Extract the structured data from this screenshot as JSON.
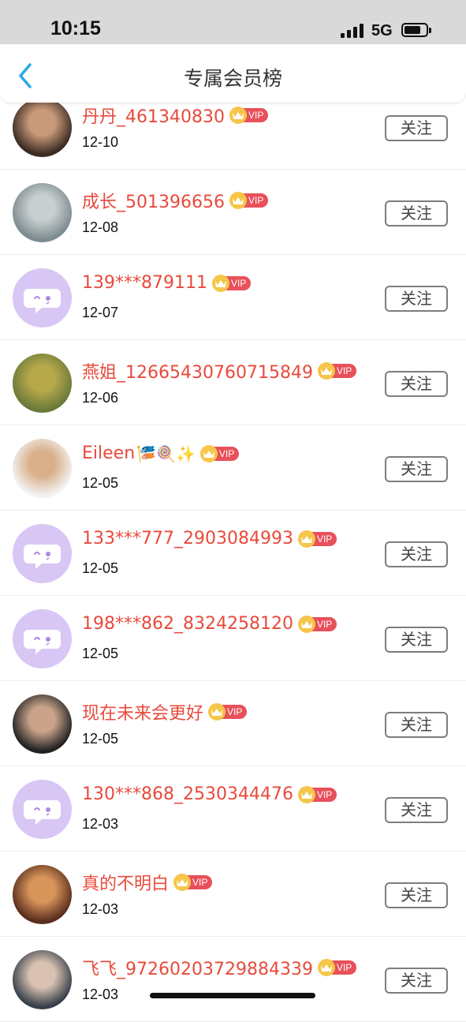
{
  "status_bar": {
    "time": "10:15",
    "network": "5G",
    "battery_level": 0.75
  },
  "nav": {
    "title": "专属会员榜",
    "back_icon": "chevron-left-icon"
  },
  "vip_badge": "VIP",
  "follow_label": "关注",
  "colors": {
    "name": "#e84a3c",
    "vip": "#e8505a",
    "crown": "#f6c64a",
    "default_avatar": "#d8c6f5",
    "back": "#2aa8e8"
  },
  "members": [
    {
      "name": "丹丹_461340830",
      "date": "12-10",
      "avatar": "photo"
    },
    {
      "name": "成长_501396656",
      "date": "12-08",
      "avatar": "photo"
    },
    {
      "name": "139***879111",
      "date": "12-07",
      "avatar": "default"
    },
    {
      "name": "燕姐_1266543076071 5849",
      "date": "12-06",
      "avatar": "photo"
    },
    {
      "name": "Eileen",
      "emoji": "🎏🍭✨",
      "date": "12-05",
      "avatar": "photo"
    },
    {
      "name": "133***777_2903084993",
      "date": "12-05",
      "avatar": "default"
    },
    {
      "name": "198***862_8324258120",
      "date": "12-05",
      "avatar": "default"
    },
    {
      "name": "现在未来会更好",
      "date": "12-05",
      "avatar": "photo"
    },
    {
      "name": "130***868_2530344476",
      "date": "12-03",
      "avatar": "default"
    },
    {
      "name": "真的不明白",
      "date": "12-03",
      "avatar": "photo"
    },
    {
      "name": "飞飞_97260203729884339",
      "date": "12-03",
      "avatar": "photo"
    }
  ]
}
